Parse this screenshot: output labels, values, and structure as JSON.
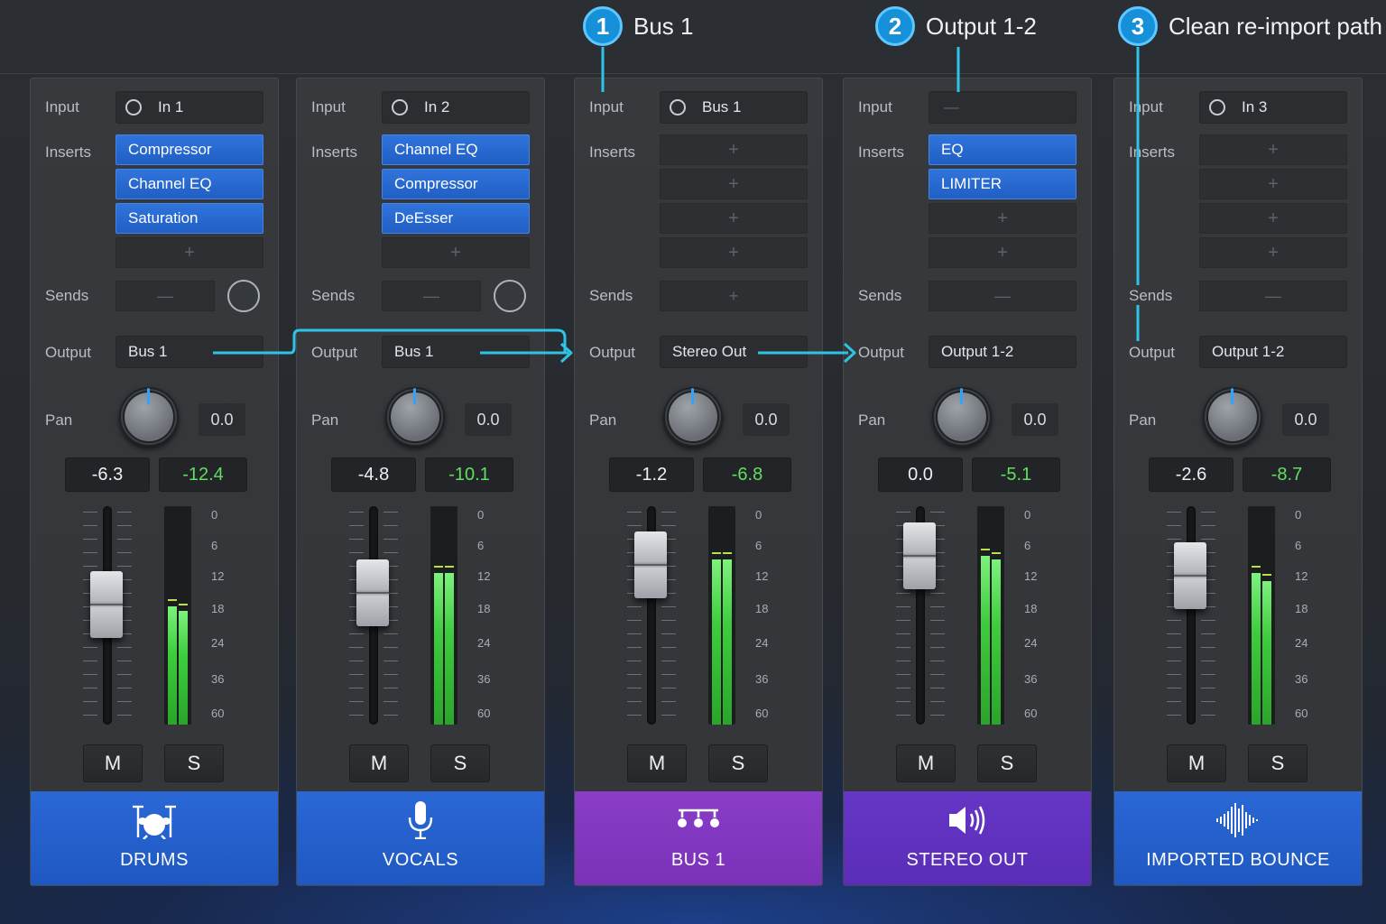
{
  "callouts": [
    {
      "num": "1",
      "text": "Bus 1"
    },
    {
      "num": "2",
      "text": "Output 1-2"
    },
    {
      "num": "3",
      "text": "Clean re-import path"
    }
  ],
  "labels": {
    "input": "Input",
    "inserts": "Inserts",
    "sends": "Sends",
    "output": "Output",
    "pan": "Pan",
    "mute": "M",
    "solo": "S",
    "empty_slot": "+",
    "empty_send": "—"
  },
  "colors": {
    "accent": "#1690d8",
    "insert_blue": "#2f74dc",
    "meter_green": "#3dcc3d",
    "track_blue": "#2a68d6",
    "bus_purple": "#8a3dc8",
    "stereo_purple": "#6636c6",
    "route_line": "#2ec4e8"
  },
  "meter_scale": [
    "0",
    "6",
    "12",
    "18",
    "24",
    "36",
    "60"
  ],
  "strips": [
    {
      "name": "DRUMS",
      "icon": "drum-kit-icon",
      "input": "In 1",
      "input_radio": true,
      "inserts": [
        "Compressor",
        "Channel EQ",
        "Saturation"
      ],
      "sends_type": "knob",
      "output": "Bus 1",
      "pan": "0.0",
      "volume": "-6.3",
      "peak": "-12.4",
      "fader_level_db": -6.3,
      "meter_level": [
        0.56,
        0.54
      ]
    },
    {
      "name": "VOCALS",
      "icon": "microphone-icon",
      "input": "In 2",
      "input_radio": true,
      "inserts": [
        "Channel EQ",
        "Compressor",
        "DeEsser"
      ],
      "sends_type": "knob",
      "output": "Bus 1",
      "pan": "0.0",
      "volume": "-4.8",
      "peak": "-10.1",
      "fader_level_db": -4.8,
      "meter_level": [
        0.72,
        0.72
      ]
    },
    {
      "name": "BUS 1",
      "icon": "bus-routing-icon",
      "input": "Bus 1",
      "input_radio": true,
      "inserts": [],
      "sends_type": "plus",
      "output": "Stereo Out",
      "pan": "0.0",
      "volume": "-1.2",
      "peak": "-6.8",
      "fader_level_db": -1.2,
      "meter_level": [
        0.78,
        0.78
      ]
    },
    {
      "name": "STEREO OUT",
      "icon": "speaker-icon",
      "input": "—",
      "input_radio": false,
      "inserts": [
        "EQ",
        "LIMITER"
      ],
      "sends_type": "dash",
      "output": "Output 1-2",
      "pan": "0.0",
      "volume": "0.0",
      "peak": "-5.1",
      "fader_level_db": 0.0,
      "meter_level": [
        0.8,
        0.78
      ]
    },
    {
      "name": "IMPORTED BOUNCE",
      "icon": "waveform-icon",
      "input": "In 3",
      "input_radio": true,
      "inserts": [],
      "sends_type": "dash",
      "output": "Output 1-2",
      "pan": "0.0",
      "volume": "-2.6",
      "peak": "-8.7",
      "fader_level_db": -2.6,
      "meter_level": [
        0.72,
        0.68
      ]
    }
  ]
}
